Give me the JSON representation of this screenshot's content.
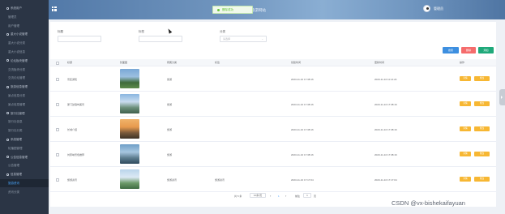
{
  "sidebar": {
    "items": [
      {
        "label": "系统用户",
        "type": "group"
      },
      {
        "label": "管理员",
        "type": "sub"
      },
      {
        "label": "用户管理",
        "type": "sub"
      },
      {
        "label": "重大小说管理",
        "type": "group"
      },
      {
        "label": "重大小说分类",
        "type": "sub"
      },
      {
        "label": "重大小说信息",
        "type": "sub"
      },
      {
        "label": "论坛板块管理",
        "type": "group"
      },
      {
        "label": "交流板块分类",
        "type": "sub"
      },
      {
        "label": "交流论坛管理",
        "type": "sub"
      },
      {
        "label": "旅游信息管理",
        "type": "group"
      },
      {
        "label": "景点信息分类",
        "type": "sub"
      },
      {
        "label": "景点信息管理",
        "type": "sub"
      },
      {
        "label": "旅行社管理",
        "type": "group"
      },
      {
        "label": "旅行社信息",
        "type": "sub"
      },
      {
        "label": "旅行社分类",
        "type": "sub"
      },
      {
        "label": "系统管理",
        "type": "group"
      },
      {
        "label": "轮播图管理",
        "type": "sub"
      },
      {
        "label": "公告信息管理",
        "type": "group"
      },
      {
        "label": "公告管理",
        "type": "sub"
      },
      {
        "label": "信息管理",
        "type": "group"
      },
      {
        "label": "旅游资讯",
        "type": "sub-active"
      },
      {
        "label": "资讯分类",
        "type": "sub"
      }
    ]
  },
  "header": {
    "title": "旅游网站",
    "toast": "删除成功",
    "username": "管理员"
  },
  "filters": {
    "title_label": "标题",
    "tag_label": "标签",
    "category_label": "分类",
    "category_placeholder": "请选择"
  },
  "actions": {
    "search": "搜索",
    "delete": "删除",
    "add": "添加"
  },
  "table": {
    "columns": [
      "标题",
      "封面图",
      "所属分类",
      "标签",
      "创建时间",
      "更新时间",
      "操作"
    ],
    "rows": [
      {
        "title": "景区通知",
        "category": "旅游",
        "tag": "",
        "created": "2023-11-10 17:38:16",
        "updated": "2023-11-10 11:14:24",
        "colors": [
          "#7aa8d6",
          "#9bbfe0",
          "#3f6b3a",
          "#5d8a4c"
        ]
      },
      {
        "title": "厦门鼓浪屿美景",
        "category": "旅游",
        "tag": "",
        "created": "2023-11-10 17:38:16",
        "updated": "2023-11-10 17:38:16",
        "colors": [
          "#8ab6e0",
          "#c9dcef",
          "#6b8f7a",
          "#3f5f4d"
        ]
      },
      {
        "title": "长城介绍",
        "category": "旅游",
        "tag": "",
        "created": "2023-11-10 17:38:16",
        "updated": "2023-11-10 17:38:16",
        "colors": [
          "#f0b36a",
          "#e79a4e",
          "#7a5a3a",
          "#3d3226"
        ]
      },
      {
        "title": "刘家峡景色推荐",
        "category": "旅游",
        "tag": "",
        "created": "2023-11-10 17:38:16",
        "updated": "2023-11-10 17:38:16",
        "colors": [
          "#6e9fc8",
          "#a7c6e0",
          "#5d7d8f",
          "#2f4a5e"
        ]
      },
      {
        "title": "旅游资讯",
        "category": "旅游资讯",
        "tag": "旅游资讯",
        "created": "2023-11-10 17:17:04",
        "updated": "2023-11-10 17:17:04",
        "colors": [
          "#b9d4ea",
          "#dce9f4",
          "#6d9a6a",
          "#3e6b42"
        ]
      }
    ],
    "detail_label": "详情",
    "edit_label": "修改"
  },
  "pagination": {
    "total_text": "共 5 条",
    "page_size": "10条/页",
    "current_page": "1",
    "goto_label": "前往",
    "goto_value": "1",
    "page_suffix": "页"
  },
  "watermark": "CSDN @vx-bishekaifayuan"
}
